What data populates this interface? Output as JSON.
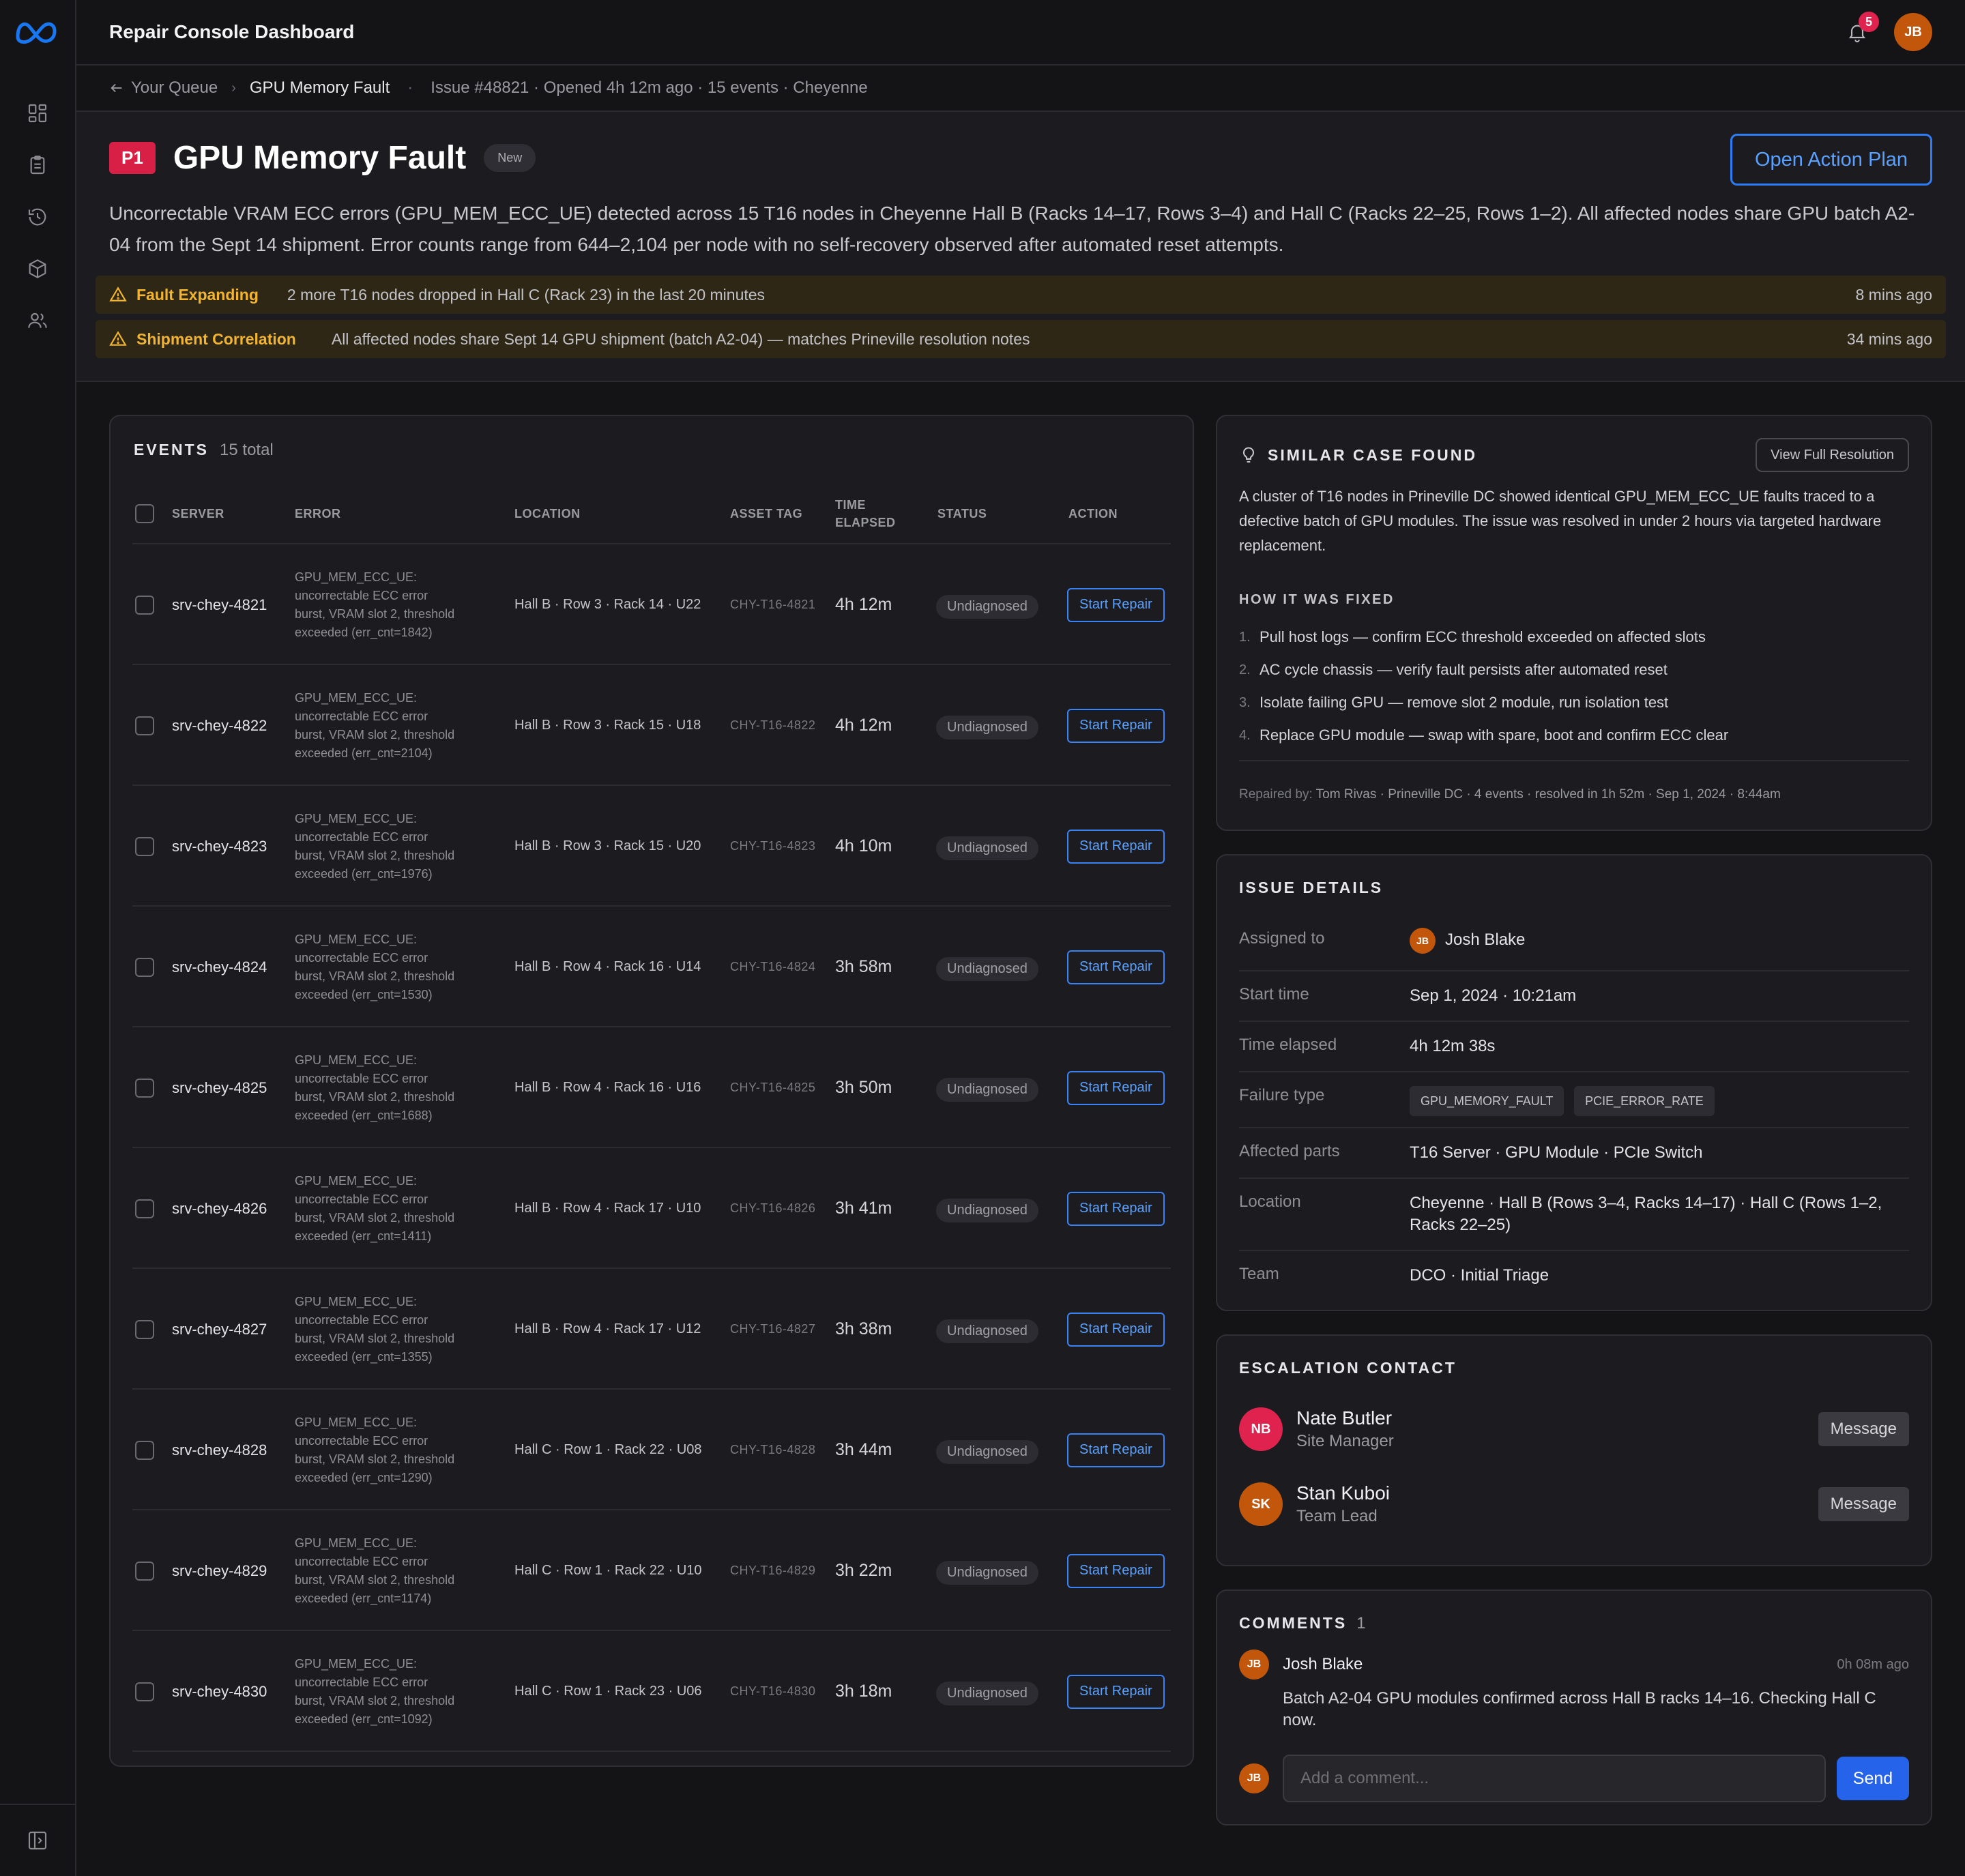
{
  "app": {
    "title": "Repair Console Dashboard",
    "notification_count": "5",
    "user_initials": "JB"
  },
  "sidebar": {
    "icons": [
      "dashboard-icon",
      "clipboard-icon",
      "history-icon",
      "package-icon",
      "users-icon"
    ],
    "bottom_icon": "panel-toggle-icon"
  },
  "breadcrumb": {
    "back_label": "Your Queue",
    "current": "GPU Memory Fault",
    "meta": "Issue #48821 · Opened 4h 12m ago · 15 events · Cheyenne"
  },
  "issue": {
    "priority": "P1",
    "title": "GPU Memory Fault",
    "status": "New",
    "action_label": "Open Action Plan",
    "description": "Uncorrectable VRAM ECC errors (GPU_MEM_ECC_UE) detected across 15 T16 nodes in Cheyenne Hall B (Racks 14–17, Rows 3–4) and Hall C (Racks 22–25, Rows 1–2). All affected nodes share GPU batch A2-04 from the Sept 14 shipment. Error counts range from 644–2,104 per node with no self-recovery observed after automated reset attempts."
  },
  "alerts": [
    {
      "title": "Fault Expanding",
      "text": "2 more T16 nodes dropped in Hall C (Rack 23) in the last 20 minutes",
      "time": "8 mins ago"
    },
    {
      "title": "Shipment Correlation",
      "text": "All affected nodes share Sept 14 GPU shipment (batch A2-04) — matches Prineville resolution notes",
      "time": "34 mins ago"
    }
  ],
  "events": {
    "label": "EVENTS",
    "count": "15 total",
    "columns": {
      "server": "SERVER",
      "error": "ERROR",
      "location": "LOCATION",
      "asset": "ASSET TAG",
      "time": "TIME ELAPSED",
      "status": "STATUS",
      "action": "ACTION"
    },
    "rows": [
      {
        "server": "srv-chey-4821",
        "error": "GPU_MEM_ECC_UE: uncorrectable ECC error burst, VRAM slot 2, threshold exceeded (err_cnt=1842)",
        "location": "Hall B · Row 3 · Rack 14 · U22",
        "asset": "CHY-T16-4821",
        "time": "4h 12m",
        "status": "Undiagnosed",
        "action": "Start Repair"
      },
      {
        "server": "srv-chey-4822",
        "error": "GPU_MEM_ECC_UE: uncorrectable ECC error burst, VRAM slot 2, threshold exceeded (err_cnt=2104)",
        "location": "Hall B · Row 3 · Rack 15 · U18",
        "asset": "CHY-T16-4822",
        "time": "4h 12m",
        "status": "Undiagnosed",
        "action": "Start Repair"
      },
      {
        "server": "srv-chey-4823",
        "error": "GPU_MEM_ECC_UE: uncorrectable ECC error burst, VRAM slot 2, threshold exceeded (err_cnt=1976)",
        "location": "Hall B · Row 3 · Rack 15 · U20",
        "asset": "CHY-T16-4823",
        "time": "4h 10m",
        "status": "Undiagnosed",
        "action": "Start Repair"
      },
      {
        "server": "srv-chey-4824",
        "error": "GPU_MEM_ECC_UE: uncorrectable ECC error burst, VRAM slot 2, threshold exceeded (err_cnt=1530)",
        "location": "Hall B · Row 4 · Rack 16 · U14",
        "asset": "CHY-T16-4824",
        "time": "3h 58m",
        "status": "Undiagnosed",
        "action": "Start Repair"
      },
      {
        "server": "srv-chey-4825",
        "error": "GPU_MEM_ECC_UE: uncorrectable ECC error burst, VRAM slot 2, threshold exceeded (err_cnt=1688)",
        "location": "Hall B · Row 4 · Rack 16 · U16",
        "asset": "CHY-T16-4825",
        "time": "3h 50m",
        "status": "Undiagnosed",
        "action": "Start Repair"
      },
      {
        "server": "srv-chey-4826",
        "error": "GPU_MEM_ECC_UE: uncorrectable ECC error burst, VRAM slot 2, threshold exceeded (err_cnt=1411)",
        "location": "Hall B · Row 4 · Rack 17 · U10",
        "asset": "CHY-T16-4826",
        "time": "3h 41m",
        "status": "Undiagnosed",
        "action": "Start Repair"
      },
      {
        "server": "srv-chey-4827",
        "error": "GPU_MEM_ECC_UE: uncorrectable ECC error burst, VRAM slot 2, threshold exceeded (err_cnt=1355)",
        "location": "Hall B · Row 4 · Rack 17 · U12",
        "asset": "CHY-T16-4827",
        "time": "3h 38m",
        "status": "Undiagnosed",
        "action": "Start Repair"
      },
      {
        "server": "srv-chey-4828",
        "error": "GPU_MEM_ECC_UE: uncorrectable ECC error burst, VRAM slot 2, threshold exceeded (err_cnt=1290)",
        "location": "Hall C · Row 1 · Rack 22 · U08",
        "asset": "CHY-T16-4828",
        "time": "3h 44m",
        "status": "Undiagnosed",
        "action": "Start Repair"
      },
      {
        "server": "srv-chey-4829",
        "error": "GPU_MEM_ECC_UE: uncorrectable ECC error burst, VRAM slot 2, threshold exceeded (err_cnt=1174)",
        "location": "Hall C · Row 1 · Rack 22 · U10",
        "asset": "CHY-T16-4829",
        "time": "3h 22m",
        "status": "Undiagnosed",
        "action": "Start Repair"
      },
      {
        "server": "srv-chey-4830",
        "error": "GPU_MEM_ECC_UE: uncorrectable ECC error burst, VRAM slot 2, threshold exceeded (err_cnt=1092)",
        "location": "Hall C · Row 1 · Rack 23 · U06",
        "asset": "CHY-T16-4830",
        "time": "3h 18m",
        "status": "Undiagnosed",
        "action": "Start Repair"
      }
    ]
  },
  "similar": {
    "label": "SIMILAR CASE FOUND",
    "button": "View Full Resolution",
    "description": "A cluster of T16 nodes in Prineville DC showed identical GPU_MEM_ECC_UE faults traced to a defective batch of GPU modules. The issue was resolved in under 2 hours via targeted hardware replacement.",
    "how_label": "HOW IT WAS FIXED",
    "steps": [
      "Pull host logs — confirm ECC threshold exceeded on affected slots",
      "AC cycle chassis — verify fault persists after automated reset",
      "Isolate failing GPU — remove slot 2 module, run isolation test",
      "Replace GPU module — swap with spare, boot and confirm ECC clear"
    ],
    "repaired_label": "Repaired by:",
    "repaired_value": "Tom Rivas · Prineville DC · 4 events · resolved in 1h 52m · Sep 1, 2024 · 8:44am"
  },
  "details": {
    "label": "ISSUE DETAILS",
    "assigned_key": "Assigned to",
    "assigned_initials": "JB",
    "assigned_name": "Josh Blake",
    "start_key": "Start time",
    "start_val": "Sep 1, 2024 · 10:21am",
    "elapsed_key": "Time elapsed",
    "elapsed_val": "4h 12m 38s",
    "failure_key": "Failure type",
    "failure_chips": [
      "GPU_MEMORY_FAULT",
      "PCIE_ERROR_RATE"
    ],
    "parts_key": "Affected parts",
    "parts_val": "T16 Server · GPU Module · PCIe Switch",
    "location_key": "Location",
    "location_val": "Cheyenne · Hall B (Rows 3–4, Racks 14–17) · Hall C (Rows 1–2, Racks 22–25)",
    "team_key": "Team",
    "team_val": "DCO · Initial Triage"
  },
  "escalation": {
    "label": "ESCALATION CONTACT",
    "contacts": [
      {
        "initials": "NB",
        "name": "Nate Butler",
        "role": "Site Manager",
        "action": "Message",
        "color": "#e0234e"
      },
      {
        "initials": "SK",
        "name": "Stan Kuboi",
        "role": "Team Lead",
        "action": "Message",
        "color": "#c2570c"
      }
    ]
  },
  "comments": {
    "label": "COMMENTS",
    "count": "1",
    "items": [
      {
        "initials": "JB",
        "author": "Josh Blake",
        "time": "0h 08m ago",
        "text": "Batch A2-04 GPU modules confirmed across Hall B racks 14–16. Checking Hall C now."
      }
    ],
    "input_initials": "JB",
    "placeholder": "Add a comment...",
    "send_label": "Send"
  }
}
